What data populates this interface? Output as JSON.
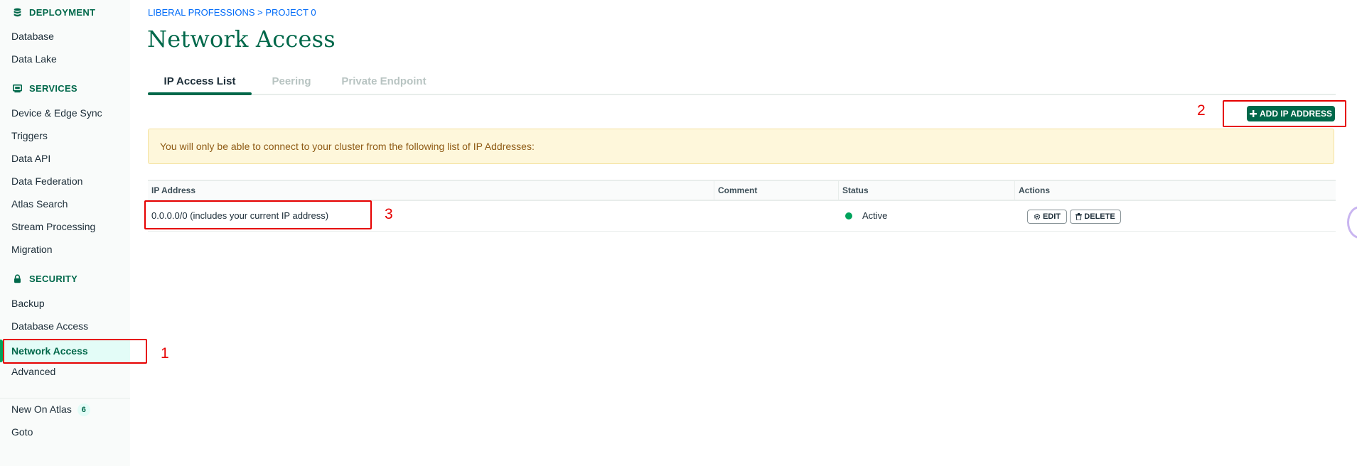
{
  "sidebar": {
    "deployment": {
      "header": "DEPLOYMENT",
      "items": [
        "Database",
        "Data Lake"
      ]
    },
    "services": {
      "header": "SERVICES",
      "items": [
        "Device & Edge Sync",
        "Triggers",
        "Data API",
        "Data Federation",
        "Atlas Search",
        "Stream Processing",
        "Migration"
      ]
    },
    "security": {
      "header": "SECURITY",
      "items": [
        "Backup",
        "Database Access",
        "Network Access",
        "Advanced"
      ]
    },
    "active_item": "Network Access",
    "extra": {
      "new_on_atlas": "New On Atlas",
      "new_on_atlas_badge": "6",
      "goto": "Goto"
    }
  },
  "breadcrumb": "LIBERAL PROFESSIONS > PROJECT 0",
  "page_title": "Network Access",
  "tabs": [
    {
      "label": "IP Access List",
      "active": true
    },
    {
      "label": "Peering",
      "active": false
    },
    {
      "label": "Private Endpoint",
      "active": false
    }
  ],
  "add_ip_button": "ADD IP ADDRESS",
  "alert_text": "You will only be able to connect to your cluster from the following list of IP Addresses:",
  "table": {
    "headers": [
      "IP Address",
      "Comment",
      "Status",
      "Actions"
    ],
    "rows": [
      {
        "ip": "0.0.0.0/0  (includes your current IP address)",
        "comment": "",
        "status": "Active",
        "edit": "EDIT",
        "delete": "DELETE"
      }
    ]
  },
  "annotations": [
    "1",
    "2",
    "3"
  ],
  "colors": {
    "brand_green": "#00684a",
    "active_dot": "#00a35c",
    "link_blue": "#016bf8",
    "alert_bg": "#fef7db",
    "annotation_red": "#e60000"
  },
  "icons": [
    "database-icon",
    "services-icon",
    "lock-icon",
    "plus-icon",
    "gear-icon",
    "trash-icon"
  ]
}
